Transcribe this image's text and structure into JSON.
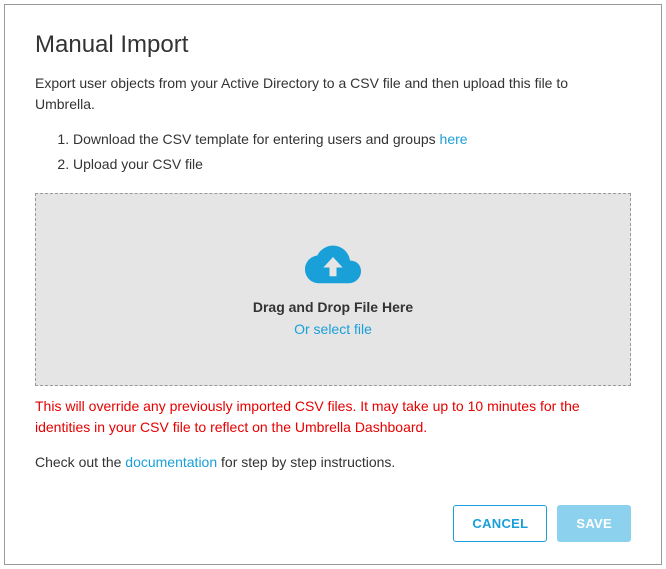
{
  "title": "Manual Import",
  "description": "Export user objects from your Active Directory to a CSV file and then upload this file to Umbrella.",
  "steps": {
    "step1_prefix": "Download the CSV template for entering users and groups ",
    "step1_link": "here",
    "step2": "Upload your CSV file"
  },
  "dropzone": {
    "title": "Drag and Drop File Here",
    "or_select": "Or select file"
  },
  "warning": "This will override any previously imported CSV files. It may take up to 10 minutes for the identities in your CSV file to reflect on the Umbrella Dashboard.",
  "footer": {
    "prefix": "Check out the ",
    "link": "documentation",
    "suffix": " for step by step instructions."
  },
  "buttons": {
    "cancel": "CANCEL",
    "save": "SAVE"
  },
  "colors": {
    "link": "#1aa0d9",
    "warning": "#e60000",
    "icon": "#1aa0d9"
  }
}
